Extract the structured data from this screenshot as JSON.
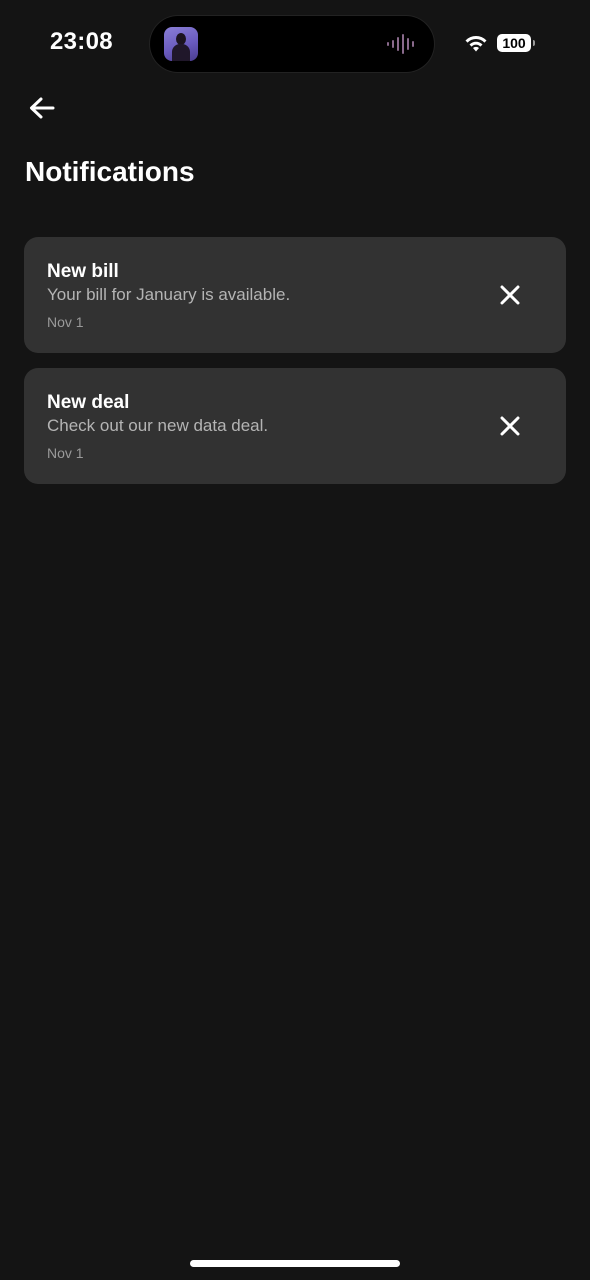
{
  "status_bar": {
    "time": "23:08",
    "battery_level": "100",
    "wifi_icon": "wifi-icon",
    "island_icon": "audio-waveform-icon"
  },
  "header": {
    "back_icon": "arrow-left-icon",
    "title": "Notifications"
  },
  "notifications": [
    {
      "title": "New bill",
      "body": "Your bill for January is available.",
      "date": "Nov 1",
      "dismiss_icon": "close-icon"
    },
    {
      "title": "New deal",
      "body": "Check out our new data deal.",
      "date": "Nov 1",
      "dismiss_icon": "close-icon"
    }
  ],
  "colors": {
    "background": "#141414",
    "card": "#323232",
    "text_primary": "#ffffff",
    "text_secondary": "#b4b4b4"
  }
}
